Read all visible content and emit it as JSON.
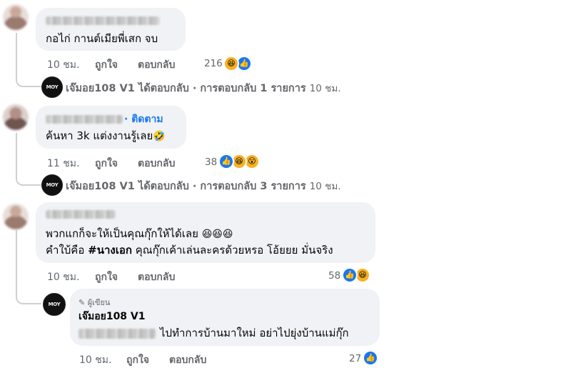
{
  "comments": [
    {
      "text": "กอไก่ กานต์เมียพี่เสก จบ",
      "time": "10 ชม.",
      "like_label": "ถูกใจ",
      "reply_label": "ตอบกลับ",
      "reaction_count": "216",
      "reactions": [
        "haha-icon",
        "like-icon"
      ],
      "reply_summary": {
        "author": "เจ๊มอย108 V1",
        "text": "ได้ตอบกลับ · การตอบกลับ 1 รายการ",
        "time": "10 ชม."
      }
    },
    {
      "follow_label": "· ติดตาม",
      "text": "ค้นหา 3k แต่งงานรู้เลย",
      "time": "11 ชม.",
      "like_label": "ถูกใจ",
      "reply_label": "ตอบกลับ",
      "reaction_count": "38",
      "reactions": [
        "like-icon",
        "haha-icon",
        "wow-icon"
      ],
      "reply_summary": {
        "author": "เจ๊มอย108 V1",
        "text": "ได้ตอบกลับ · การตอบกลับ 3 รายการ",
        "time": "10 ชม."
      }
    },
    {
      "line1": "พวกแกก็จะให้เป็นคุณกุ๊กให้ได้เลย",
      "line2_prefix": "คำใบ้คือ",
      "line2_hashtag": "#นางเอก",
      "line2_suffix": "คุณกุ๊กเค้าเล่นละครด้วยหรอ โอ้ยยย มั่นจริง",
      "time": "10 ชม.",
      "like_label": "ถูกใจ",
      "reply_label": "ตอบกลับ",
      "reaction_count": "58",
      "reactions": [
        "like-icon",
        "haha-icon"
      ],
      "reply": {
        "badge": "ผู้เขียน",
        "author": "เจ๊มอย108 V1",
        "text": "ไปทำการบ้านมาใหม่ อย่าไปยุ่งบ้านแม่กุ๊ก",
        "time": "10 ชม.",
        "like_label": "ถูกใจ",
        "reply_label": "ตอบกลับ",
        "reaction_count": "27",
        "reactions": [
          "like-icon"
        ]
      }
    }
  ],
  "page_logo": "MOY"
}
